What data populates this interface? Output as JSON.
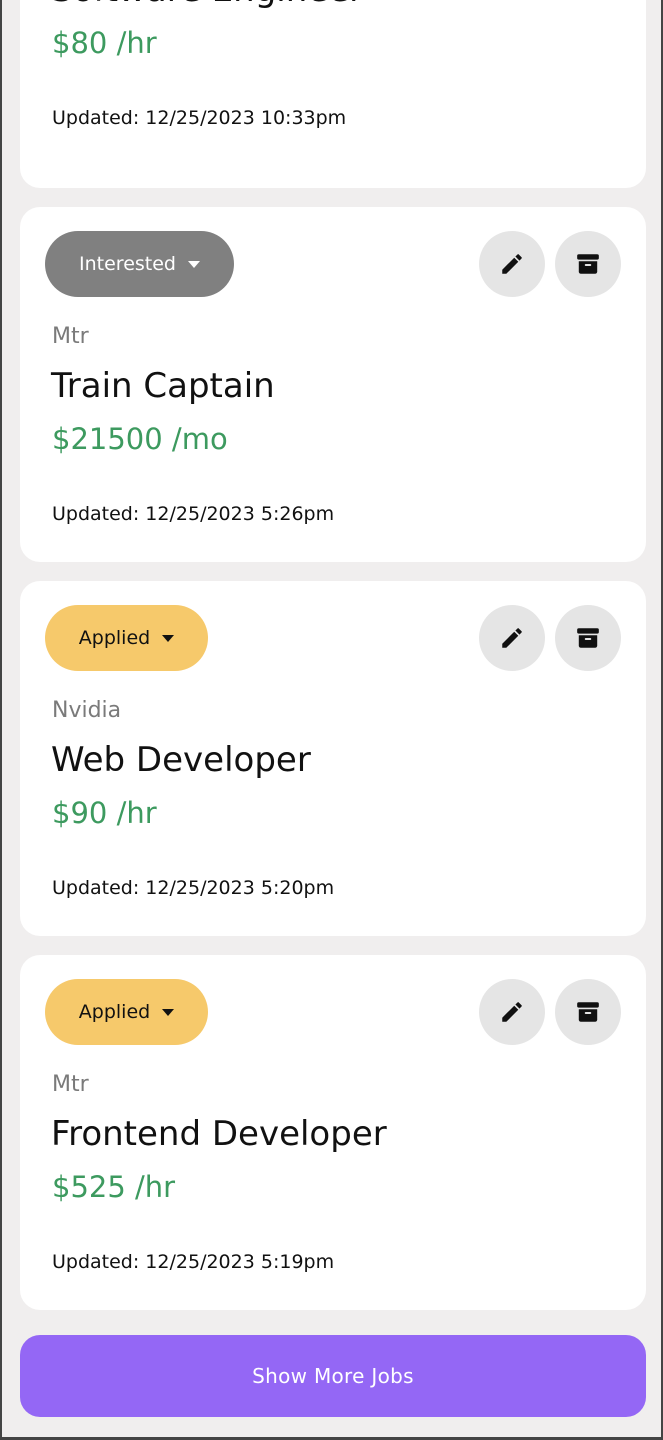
{
  "jobs": [
    {
      "status": "",
      "company": "",
      "title": "Software Engineer",
      "salary": "$80 /hr",
      "updated": "Updated: 12/25/2023 10:33pm"
    },
    {
      "status": "Interested",
      "company": "Mtr",
      "title": "Train Captain",
      "salary": "$21500 /mo",
      "updated": "Updated: 12/25/2023 5:26pm"
    },
    {
      "status": "Applied",
      "company": "Nvidia",
      "title": "Web Developer",
      "salary": "$90 /hr",
      "updated": "Updated: 12/25/2023 5:20pm"
    },
    {
      "status": "Applied",
      "company": "Mtr",
      "title": "Frontend Developer",
      "salary": "$525 /hr",
      "updated": "Updated: 12/25/2023 5:19pm"
    }
  ],
  "icons": {
    "edit": "pencil-icon",
    "archive": "archive-icon",
    "dropdown": "caret-down-icon"
  },
  "colors": {
    "background": "#f0eeee",
    "card": "#ffffff",
    "status_interested": "#808080",
    "status_applied": "#f6c96b",
    "salary": "#3d9a5f",
    "primary_button": "#9467f5"
  },
  "show_more_label": "Show More Jobs"
}
